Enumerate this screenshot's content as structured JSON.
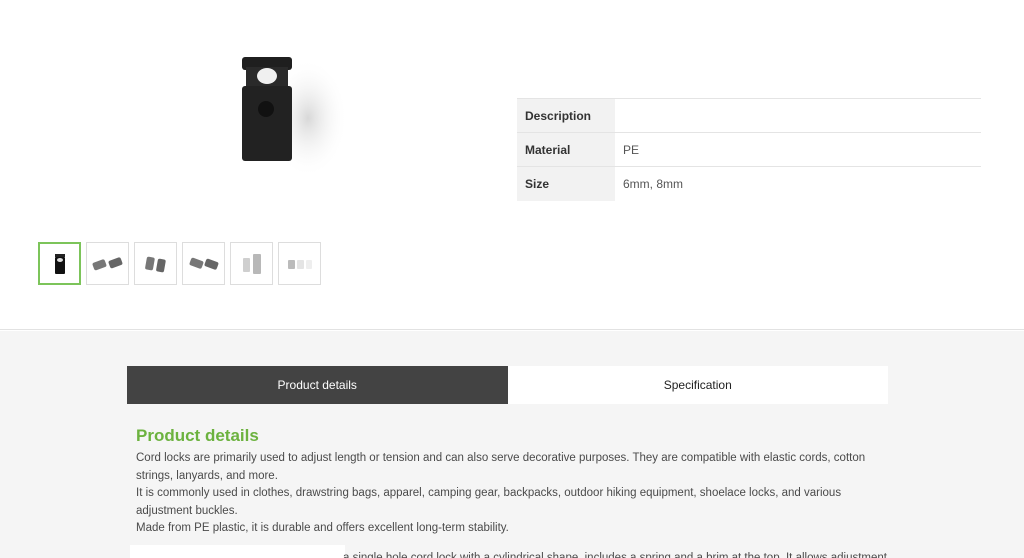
{
  "gallery": {
    "thumbnails": [
      {
        "name": "black-cord-lock",
        "active": true
      },
      {
        "name": "grey-cord-locks-pair-1",
        "active": false
      },
      {
        "name": "grey-cord-locks-pair-2",
        "active": false
      },
      {
        "name": "grey-cord-locks-pair-3",
        "active": false
      },
      {
        "name": "clear-cord-locks",
        "active": false
      },
      {
        "name": "white-cord-locks",
        "active": false
      }
    ]
  },
  "spec_table": {
    "rows": [
      {
        "label": "Description",
        "value": ""
      },
      {
        "label": "Material",
        "value": "PE"
      },
      {
        "label": "Size",
        "value": "6mm, 8mm"
      }
    ]
  },
  "tabs": {
    "product_details": "Product details",
    "specification": "Specification"
  },
  "details": {
    "title": "Product details",
    "paragraph1": "Cord locks are primarily used to adjust length or tension and can also serve decorative purposes. They are compatible with elastic cords, cotton strings, lanyards, and more.",
    "paragraph2": "It is commonly used in clothes, drawstring bags, apparel, camping gear, backpacks, outdoor hiking equipment, shoelace locks, and various adjustment buckles.",
    "paragraph3": "Made from PE plastic, it is durable and offers excellent long-term stability.",
    "paragraph4_partial": "a single hole cord lock with a cylindrical shape, includes a spring and a brim at the top. It allows adjustment of"
  },
  "colors": {
    "accent_green": "#6cb23f",
    "tab_active_bg": "#434343",
    "thumb_active_border": "#7cc45a"
  }
}
